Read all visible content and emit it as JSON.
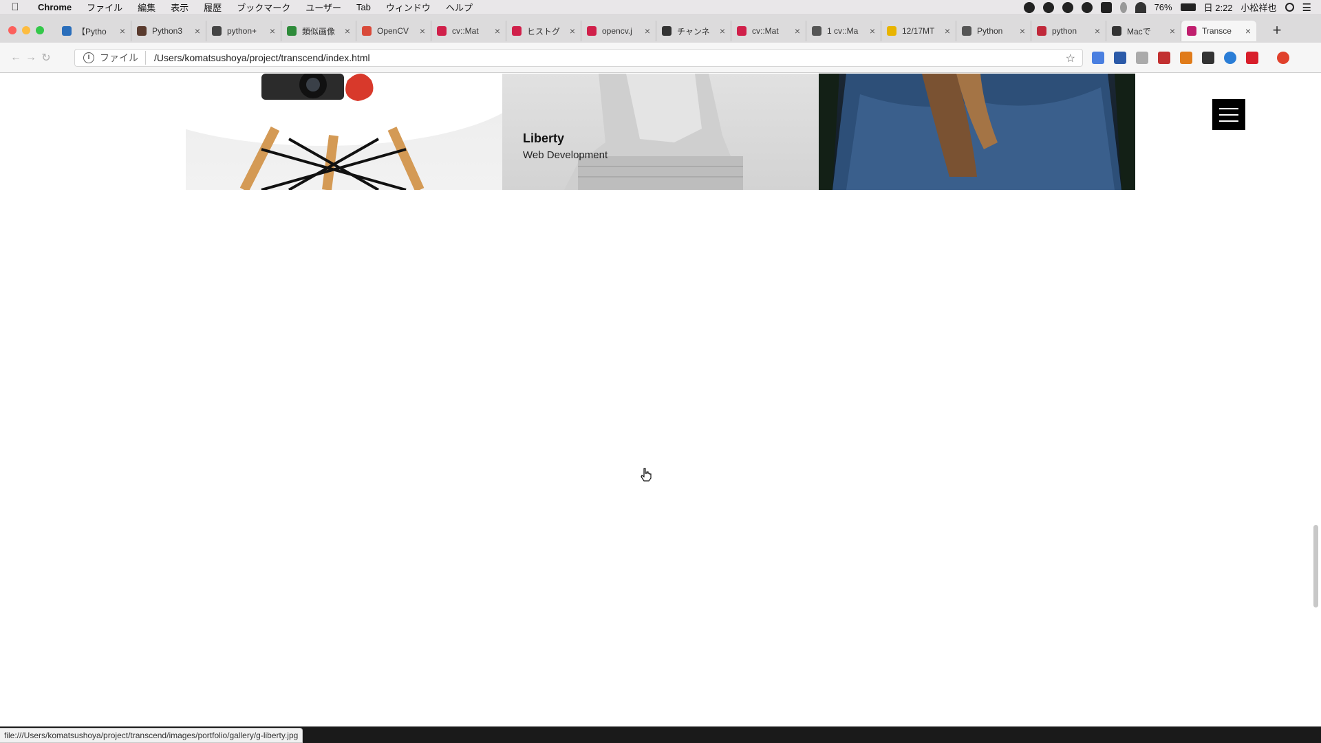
{
  "menubar": {
    "app": "Chrome",
    "items": [
      "ファイル",
      "編集",
      "表示",
      "履歴",
      "ブックマーク",
      "ユーザー",
      "Tab",
      "ウィンドウ",
      "ヘルプ"
    ],
    "battery": "76%",
    "clock": "日 2:22",
    "user": "小松祥也"
  },
  "tabs": [
    {
      "label": "【Pytho",
      "color": "#2a6ebb"
    },
    {
      "label": "Python3",
      "color": "#5a3b2e"
    },
    {
      "label": "python+",
      "color": "#444444"
    },
    {
      "label": "類似画像",
      "color": "#2e8b3a"
    },
    {
      "label": "OpenCV",
      "color": "#d94a3a"
    },
    {
      "label": "cv::Mat",
      "color": "#d0204a"
    },
    {
      "label": "ヒストグ",
      "color": "#d0204a"
    },
    {
      "label": "opencv.j",
      "color": "#d0204a"
    },
    {
      "label": "チャンネ",
      "color": "#333333"
    },
    {
      "label": "cv::Mat",
      "color": "#d0204a"
    },
    {
      "label": "1 cv::Ma",
      "color": "#555555"
    },
    {
      "label": "12/17MT",
      "color": "#e8b400"
    },
    {
      "label": "Python",
      "color": "#555555"
    },
    {
      "label": "python",
      "color": "#c0283a"
    },
    {
      "label": "Macで",
      "color": "#333333"
    },
    {
      "label": "Transce",
      "color": "#c01f6e"
    }
  ],
  "address": {
    "scheme": "ファイル",
    "url": "/Users/komatsushoya/project/transcend/index.html"
  },
  "gallery": {
    "item_title": "Liberty",
    "item_subtitle": "Web Development"
  },
  "status": {
    "url": "file:///Users/komatsushoya/project/transcend/images/portfolio/gallery/g-liberty.jpg"
  }
}
